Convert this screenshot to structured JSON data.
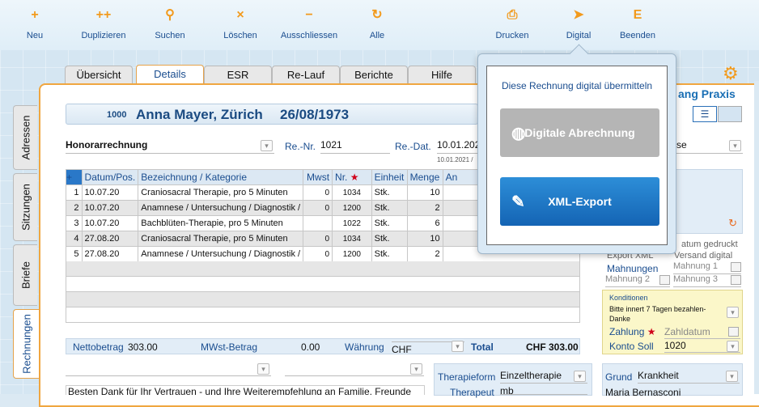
{
  "toolbar": {
    "items": [
      {
        "icon": "+",
        "label": "Neu"
      },
      {
        "icon": "++",
        "label": "Duplizieren"
      },
      {
        "icon": "⚲",
        "label": "Suchen"
      },
      {
        "icon": "×",
        "label": "Löschen"
      },
      {
        "icon": "−",
        "label": "Ausschliessen"
      },
      {
        "icon": "↻",
        "label": "Alle"
      },
      {
        "icon": "⎙",
        "label": "Drucken"
      },
      {
        "icon": "➤",
        "label": "Digital"
      },
      {
        "icon": "E",
        "label": "Beenden"
      }
    ]
  },
  "tabs": [
    "Übersicht",
    "Details",
    "ESR",
    "Re-Lauf",
    "Berichte",
    "Hilfe"
  ],
  "side_tabs": [
    "Adressen",
    "Sitzungen",
    "Briefe",
    "Rechnungen"
  ],
  "patient": {
    "id": "1000",
    "name": "Anna Mayer, Zürich",
    "dob": "26/08/1973"
  },
  "invoice": {
    "type": "Honorarrechnung",
    "re_nr_label": "Re.-Nr.",
    "re_nr": "1021",
    "re_dat_label": "Re.-Dat.",
    "re_dat": "10.01.202",
    "re_dat_sub": "10.01.2021 /",
    "praxis_partial": "ang Praxis",
    "right_select_partial": "se"
  },
  "table": {
    "headers": [
      "Datum/Pos.",
      "Bezeichnung / Kategorie",
      "Mwst",
      "Nr.",
      "Einheit",
      "Menge",
      "An"
    ],
    "rows": [
      {
        "n": "1",
        "date": "10.07.20",
        "desc": "Craniosacral Therapie, pro 5 Minuten",
        "mwst": "0",
        "nr": "1034",
        "unit": "Stk.",
        "qty": "10"
      },
      {
        "n": "2",
        "date": "10.07.20",
        "desc": "Anamnese / Untersuchung / Diagnostik /",
        "mwst": "0",
        "nr": "1200",
        "unit": "Stk.",
        "qty": "2"
      },
      {
        "n": "3",
        "date": "10.07.20",
        "desc": "Bachblüten-Therapie, pro 5 Minuten",
        "mwst": "",
        "nr": "1022",
        "unit": "Stk.",
        "qty": "6"
      },
      {
        "n": "4",
        "date": "27.08.20",
        "desc": "Craniosacral Therapie, pro 5 Minuten",
        "mwst": "0",
        "nr": "1034",
        "unit": "Stk.",
        "qty": "10"
      },
      {
        "n": "5",
        "date": "27.08.20",
        "desc": "Anamnese / Untersuchung / Diagnostik /",
        "mwst": "0",
        "nr": "1200",
        "unit": "Stk.",
        "qty": "2"
      }
    ]
  },
  "totals": {
    "netto_label": "Nettobetrag",
    "netto": "303.00",
    "mwst_label": "MWst-Betrag",
    "mwst": "0.00",
    "waehrung_label": "Währung",
    "waehrung": "CHF",
    "total_label": "Total",
    "total": "CHF 303.00"
  },
  "right": {
    "datum_gedruckt": "atum gedruckt",
    "export_xml": "Export XML",
    "versand_digital": "Versand digital",
    "mahnungen": "Mahnungen",
    "mahnung1": "Mahnung 1",
    "mahnung2": "Mahnung 2",
    "mahnung3": "Mahnung 3",
    "konditionen_label": "Konditionen",
    "konditionen_text": "Bitte innert 7 Tagen bezahlen-Danke",
    "zahlung": "Zahlung",
    "zahldatum": "Zahldatum",
    "konto_soll_label": "Konto Soll",
    "konto_soll": "1020"
  },
  "bottom": {
    "note": "Besten Dank für Ihr Vertrauen - und Ihre Weiterempfehlung an Familie, Freunde",
    "therapieform_label": "Therapieform",
    "therapieform": "Einzeltherapie",
    "therapeut_label": "Therapeut",
    "therapeut": "mb",
    "grund_label": "Grund",
    "grund": "Krankheit",
    "person": "Maria Bernasconi"
  },
  "popover": {
    "title": "Diese Rechnung digital übermitteln",
    "btn1": "Digitale Abrechnung",
    "btn2": "XML-Export"
  },
  "colors": {
    "accent": "#f0a640",
    "brand": "#1a4d8f",
    "button_blue": "#1f78c8"
  }
}
